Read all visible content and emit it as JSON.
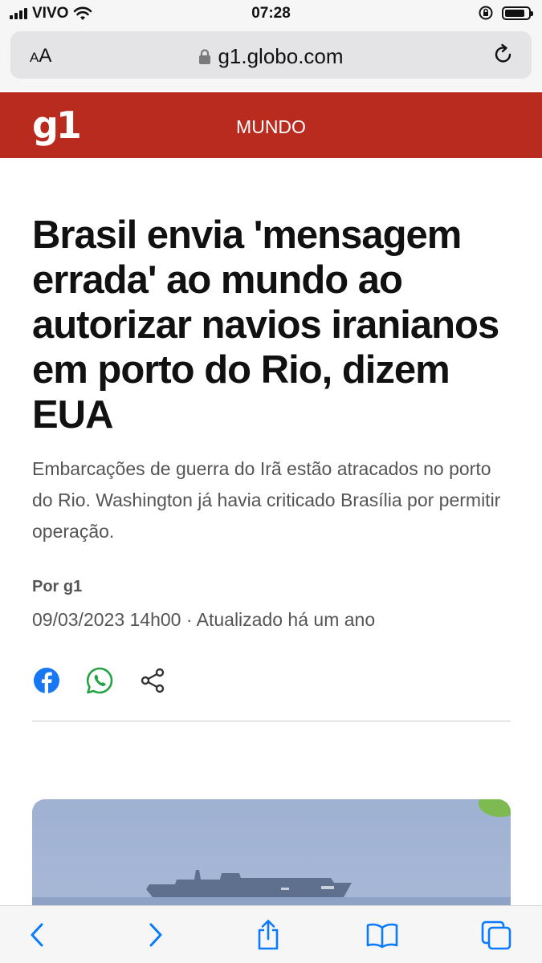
{
  "status": {
    "carrier": "VIVO",
    "time": "07:28",
    "battery_level": 0.85
  },
  "browser": {
    "text_size_label_small": "A",
    "text_size_label_large": "A",
    "url": "g1.globo.com",
    "icons": [
      "lock-icon",
      "reload-icon"
    ]
  },
  "site": {
    "logo": "g1",
    "section": "MUNDO",
    "brand_color": "#b82b1e"
  },
  "article": {
    "headline": "Brasil envia 'mensagem errada' ao mundo ao autorizar navios iranianos em porto do Rio, dizem EUA",
    "subtitle": "Embarcações de guerra do Irã estão atracados no porto do Rio. Washington já havia criticado Brasília por permitir operação.",
    "byline": "Por g1",
    "dateline": "09/03/2023 14h00 · Atualizado há um ano",
    "share_icons": [
      "facebook-icon",
      "whatsapp-icon",
      "share-icon"
    ]
  },
  "toolbar": {
    "icons": [
      "back-icon",
      "forward-icon",
      "share-sheet-icon",
      "bookmarks-icon",
      "tabs-icon"
    ],
    "accent_color": "#0a7aff"
  }
}
